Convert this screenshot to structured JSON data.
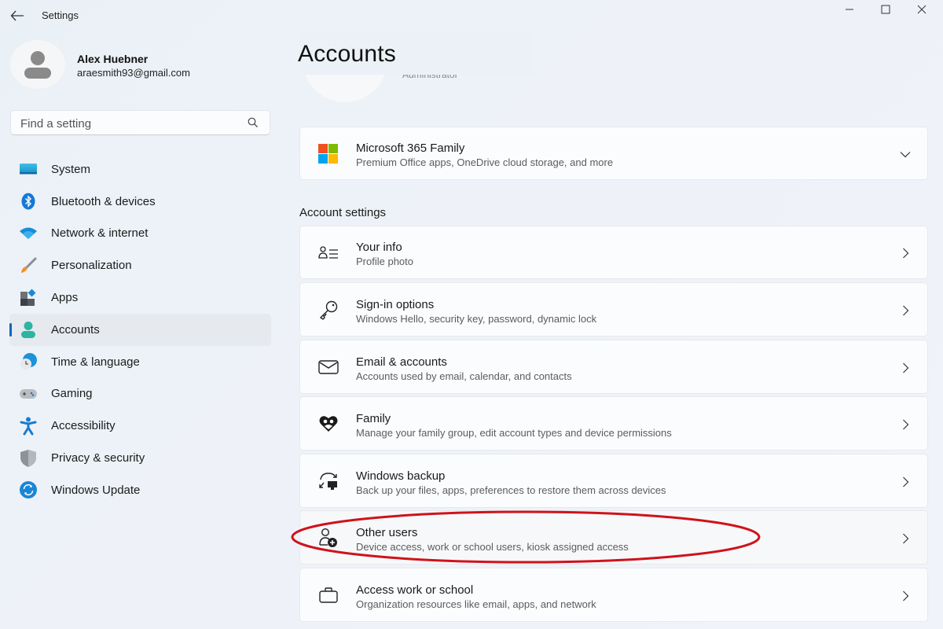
{
  "window": {
    "title": "Settings",
    "controls": {
      "minimize": "minimize-icon",
      "maximize": "maximize-icon",
      "close": "close-icon"
    }
  },
  "profile": {
    "name": "Alex Huebner",
    "email": "araesmith93@gmail.com"
  },
  "search": {
    "placeholder": "Find a setting",
    "value": ""
  },
  "sidebar": {
    "items": [
      {
        "label": "System",
        "icon": "system-icon",
        "active": false
      },
      {
        "label": "Bluetooth & devices",
        "icon": "bluetooth-icon",
        "active": false
      },
      {
        "label": "Network & internet",
        "icon": "wifi-icon",
        "active": false
      },
      {
        "label": "Personalization",
        "icon": "brush-icon",
        "active": false
      },
      {
        "label": "Apps",
        "icon": "apps-icon",
        "active": false
      },
      {
        "label": "Accounts",
        "icon": "accounts-icon",
        "active": true
      },
      {
        "label": "Time & language",
        "icon": "time-language-icon",
        "active": false
      },
      {
        "label": "Gaming",
        "icon": "gamepad-icon",
        "active": false
      },
      {
        "label": "Accessibility",
        "icon": "accessibility-icon",
        "active": false
      },
      {
        "label": "Privacy & security",
        "icon": "shield-icon",
        "active": false
      },
      {
        "label": "Windows Update",
        "icon": "update-icon",
        "active": false
      }
    ]
  },
  "main": {
    "title": "Accounts",
    "header_role": "Administrator",
    "microsoft365": {
      "title": "Microsoft 365 Family",
      "subtitle": "Premium Office apps, OneDrive cloud storage, and more",
      "icon": "microsoft-logo-icon",
      "logo_colors": [
        "#f25022",
        "#7fba00",
        "#00a4ef",
        "#ffb900"
      ]
    },
    "section_label": "Account settings",
    "settings": [
      {
        "title": "Your info",
        "subtitle": "Profile photo",
        "icon": "person-info-icon"
      },
      {
        "title": "Sign-in options",
        "subtitle": "Windows Hello, security key, password, dynamic lock",
        "icon": "key-icon"
      },
      {
        "title": "Email & accounts",
        "subtitle": "Accounts used by email, calendar, and contacts",
        "icon": "mail-icon"
      },
      {
        "title": "Family",
        "subtitle": "Manage your family group, edit account types and device permissions",
        "icon": "family-heart-icon"
      },
      {
        "title": "Windows backup",
        "subtitle": "Back up your files, apps, preferences to restore them across devices",
        "icon": "backup-icon"
      },
      {
        "title": "Other users",
        "subtitle": "Device access, work or school users, kiosk assigned access",
        "icon": "add-user-icon",
        "highlighted": true
      },
      {
        "title": "Access work or school",
        "subtitle": "Organization resources like email, apps, and network",
        "icon": "briefcase-icon"
      }
    ]
  },
  "annotation": {
    "highlight_color": "#d0121b",
    "highlight_target": "Other users"
  }
}
